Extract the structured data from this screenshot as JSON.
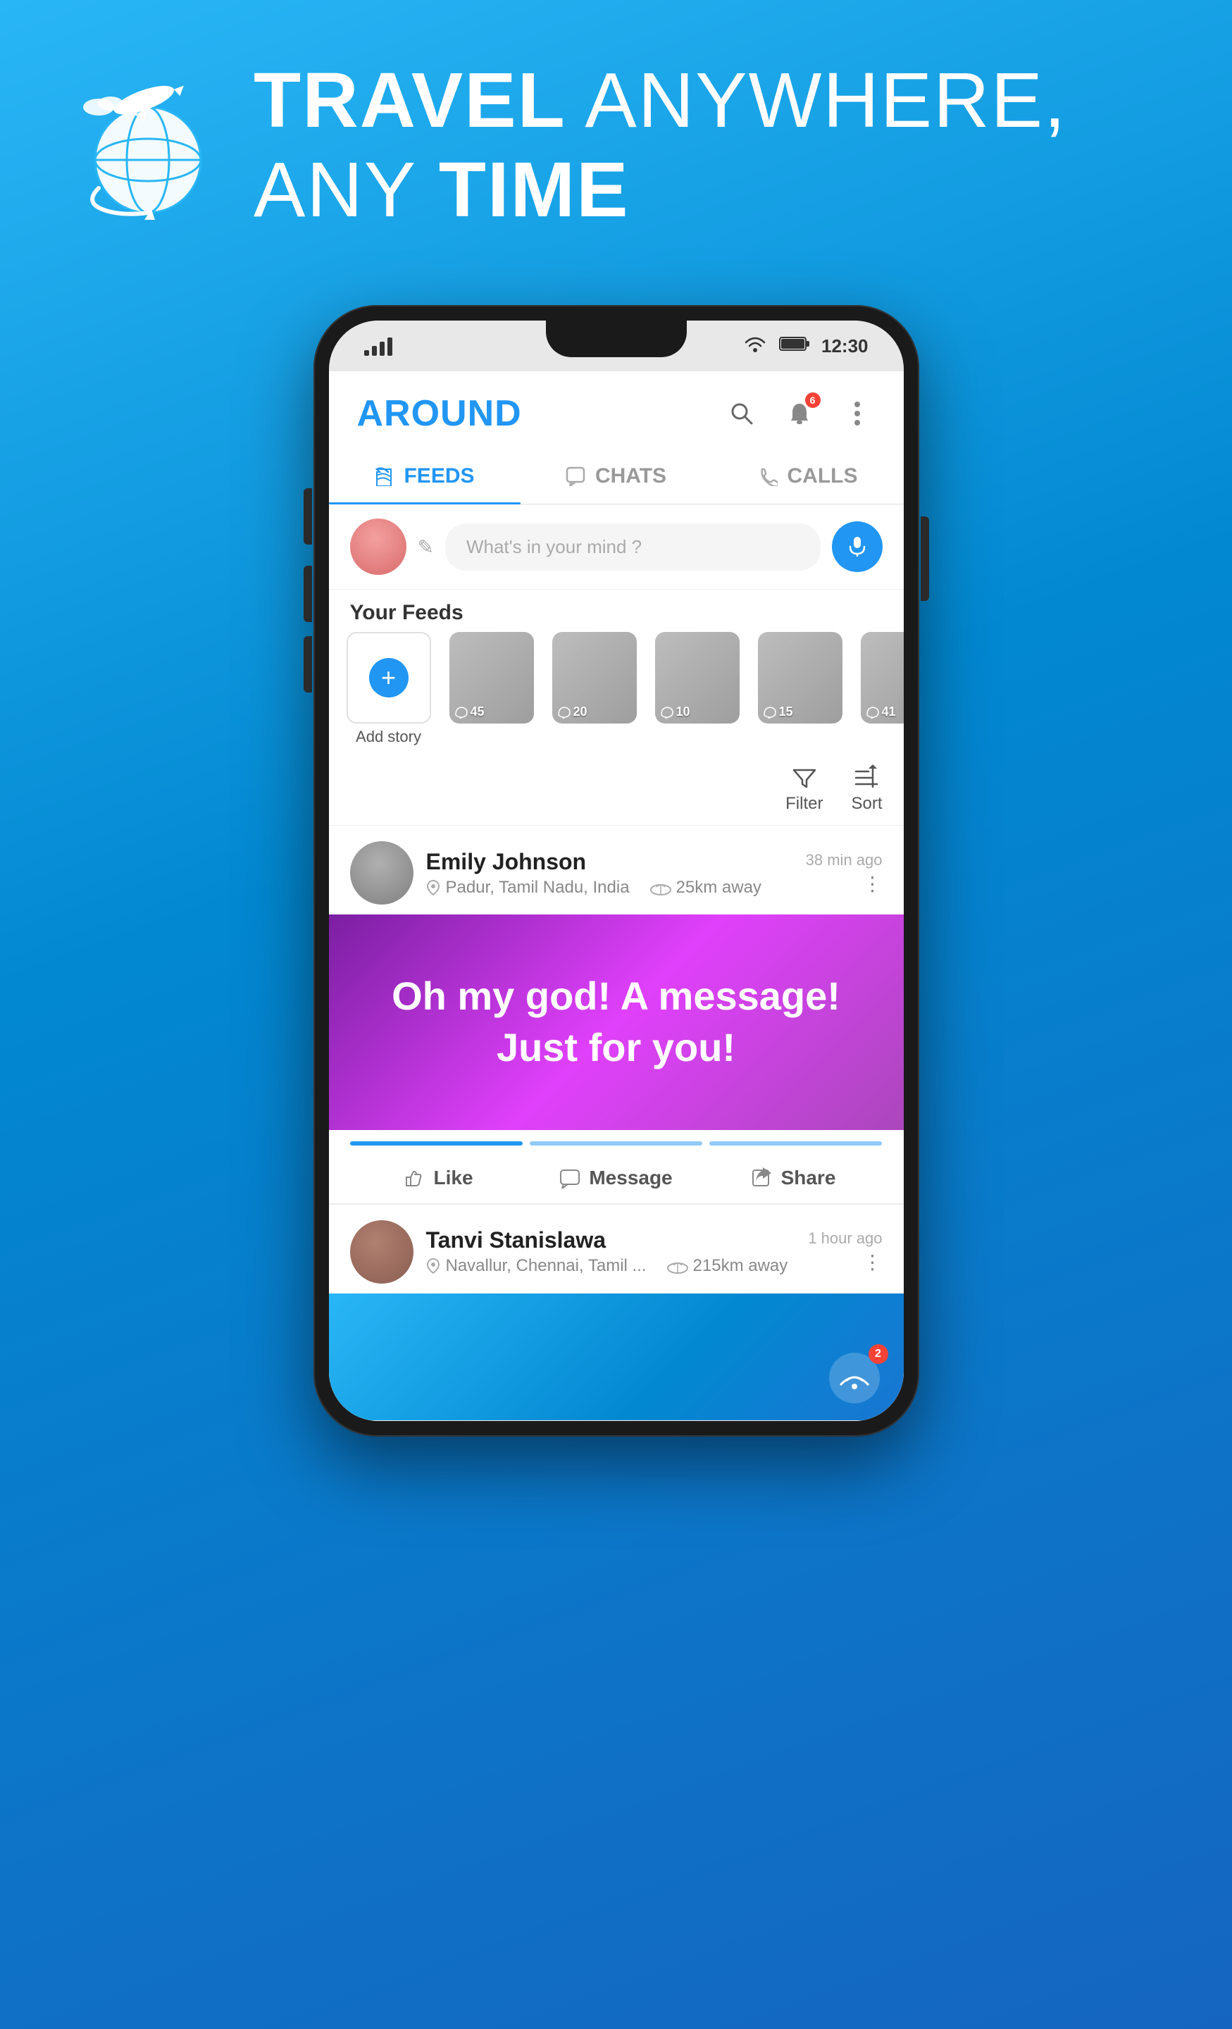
{
  "header": {
    "title_bold": "TRAVEL",
    "title_rest": " ANYWHERE,",
    "subtitle_normal": "ANY ",
    "subtitle_bold": "TIME"
  },
  "status_bar": {
    "time": "12:30"
  },
  "app": {
    "title": "AROUND",
    "tabs": [
      {
        "id": "feeds",
        "label": "FEEDS",
        "active": true
      },
      {
        "id": "chats",
        "label": "CHATS",
        "active": false
      },
      {
        "id": "calls",
        "label": "CALLS",
        "active": false
      }
    ],
    "post_input_placeholder": "What's in your mind ?",
    "feeds_section_label": "Your Feeds",
    "add_story_label": "Add story",
    "stories": [
      {
        "count": "45"
      },
      {
        "count": "20"
      },
      {
        "count": "10"
      },
      {
        "count": "15"
      },
      {
        "count": "41"
      }
    ],
    "filter_label": "Filter",
    "sort_label": "Sort",
    "posts": [
      {
        "username": "Emily Johnson",
        "location": "Padur, Tamil Nadu, India",
        "time": "38 min ago",
        "distance": "25km away",
        "message": "Oh my god! A message! Just for you!",
        "actions": {
          "like": "Like",
          "message": "Message",
          "share": "Share"
        }
      },
      {
        "username": "Tanvi Stanislawa",
        "location": "Navallur, Chennai, Tamil ...",
        "time": "1 hour ago",
        "distance": "215km away"
      }
    ],
    "notification_badge": "6"
  }
}
